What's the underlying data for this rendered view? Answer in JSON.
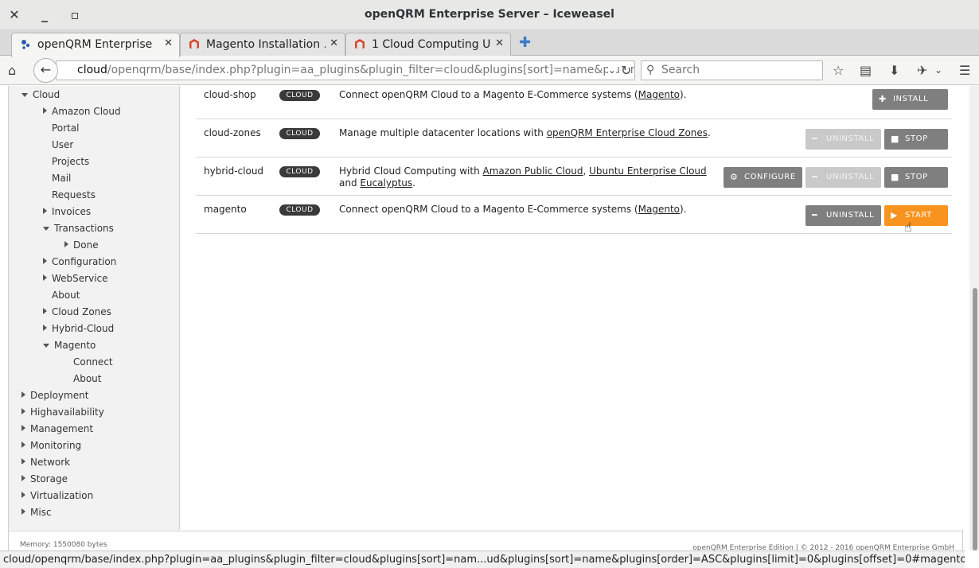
{
  "window": {
    "title": "openQRM Enterprise Server – Iceweasel"
  },
  "tabs": [
    {
      "label": "openQRM Enterprise ...",
      "close": "✕"
    },
    {
      "label": "Magento Installation ...",
      "close": "✕"
    },
    {
      "label": "1 Cloud Computing U...",
      "close": "✕"
    }
  ],
  "navbar": {
    "url_host": "cloud",
    "url_path": "/openqrm/base/index.php?plugin=aa_plugins&plugin_filter=cloud&plugins[sort]=name&plugins[c",
    "search_placeholder": "Search"
  },
  "sidebar": {
    "items": [
      {
        "label": "Cloud",
        "level": 0,
        "expander": "down"
      },
      {
        "label": "Amazon Cloud",
        "level": 1,
        "expander": "right"
      },
      {
        "label": "Portal",
        "level": 1,
        "expander": "none"
      },
      {
        "label": "User",
        "level": 1,
        "expander": "none"
      },
      {
        "label": "Projects",
        "level": 1,
        "expander": "none"
      },
      {
        "label": "Mail",
        "level": 1,
        "expander": "none"
      },
      {
        "label": "Requests",
        "level": 1,
        "expander": "none"
      },
      {
        "label": "Invoices",
        "level": 1,
        "expander": "right"
      },
      {
        "label": "Transactions",
        "level": 1,
        "expander": "down"
      },
      {
        "label": "Done",
        "level": 2,
        "expander": "right"
      },
      {
        "label": "Configuration",
        "level": 1,
        "expander": "right"
      },
      {
        "label": "WebService",
        "level": 1,
        "expander": "right"
      },
      {
        "label": "About",
        "level": 1,
        "expander": "none"
      },
      {
        "label": "Cloud Zones",
        "level": 1,
        "expander": "right"
      },
      {
        "label": "Hybrid-Cloud",
        "level": 1,
        "expander": "right"
      },
      {
        "label": "Magento",
        "level": 1,
        "expander": "down"
      },
      {
        "label": "Connect",
        "level": 2,
        "expander": "none"
      },
      {
        "label": "About",
        "level": 2,
        "expander": "none"
      },
      {
        "label": "Deployment",
        "level": 0,
        "expander": "right"
      },
      {
        "label": "Highavailability",
        "level": 0,
        "expander": "right"
      },
      {
        "label": "Management",
        "level": 0,
        "expander": "right"
      },
      {
        "label": "Monitoring",
        "level": 0,
        "expander": "right"
      },
      {
        "label": "Network",
        "level": 0,
        "expander": "right"
      },
      {
        "label": "Storage",
        "level": 0,
        "expander": "right"
      },
      {
        "label": "Virtualization",
        "level": 0,
        "expander": "right"
      },
      {
        "label": "Misc",
        "level": 0,
        "expander": "right"
      }
    ]
  },
  "plugins": [
    {
      "name": "cloud-shop",
      "badge": "CLOUD",
      "desc_parts": [
        {
          "text": "Connect openQRM Cloud to a Magento E-Commerce systems ("
        },
        {
          "text": "Magento",
          "link": true
        },
        {
          "text": ")."
        }
      ],
      "buttons": [
        {
          "label": "INSTALL",
          "icon": "plus-icon",
          "style": "dark"
        }
      ]
    },
    {
      "name": "cloud-zones",
      "badge": "CLOUD",
      "desc_parts": [
        {
          "text": "Manage multiple datacenter locations with "
        },
        {
          "text": "openQRM Enterprise Cloud Zones",
          "link": true
        },
        {
          "text": "."
        }
      ],
      "buttons": [
        {
          "label": "UNINSTALL",
          "icon": "minus-icon",
          "style": "light"
        },
        {
          "label": "STOP",
          "icon": "stop-icon",
          "style": "dark"
        }
      ]
    },
    {
      "name": "hybrid-cloud",
      "badge": "CLOUD",
      "desc_parts": [
        {
          "text": "Hybrid Cloud Computing with "
        },
        {
          "text": "Amazon Public Cloud",
          "link": true
        },
        {
          "text": ", "
        },
        {
          "text": "Ubuntu Enterprise Cloud",
          "link": true
        },
        {
          "text": " and "
        },
        {
          "text": "Eucalyptus",
          "link": true
        },
        {
          "text": "."
        }
      ],
      "buttons": [
        {
          "label": "CONFIGURE",
          "icon": "gear-icon",
          "style": "dark"
        },
        {
          "label": "UNINSTALL",
          "icon": "minus-icon",
          "style": "light"
        },
        {
          "label": "STOP",
          "icon": "stop-icon",
          "style": "dark"
        }
      ]
    },
    {
      "name": "magento",
      "badge": "CLOUD",
      "desc_parts": [
        {
          "text": "Connect openQRM Cloud to a Magento E-Commerce systems ("
        },
        {
          "text": "Magento",
          "link": true
        },
        {
          "text": ")."
        }
      ],
      "buttons": [
        {
          "label": "UNINSTALL",
          "icon": "minus-icon",
          "style": "dark"
        },
        {
          "label": "START",
          "icon": "play-icon",
          "style": "orange"
        }
      ]
    }
  ],
  "footer": {
    "memory": "Memory: 1550080 bytes",
    "copyright": "openQRM Enterprise Edition | © 2012 - 2016 openQRM Enterprise GmbH"
  },
  "statusbar": {
    "text": "cloud/openqrm/base/index.php?plugin=aa_plugins&plugin_filter=cloud&plugins[sort]=nam...ud&plugins[sort]=name&plugins[order]=ASC&plugins[limit]=0&plugins[offset]=0#magento"
  },
  "colors": {
    "accent_orange": "#f7931e",
    "badge": "#3a3a3a",
    "button_dark": "#7f7f7f",
    "button_disabled": "#c9c9c9"
  }
}
